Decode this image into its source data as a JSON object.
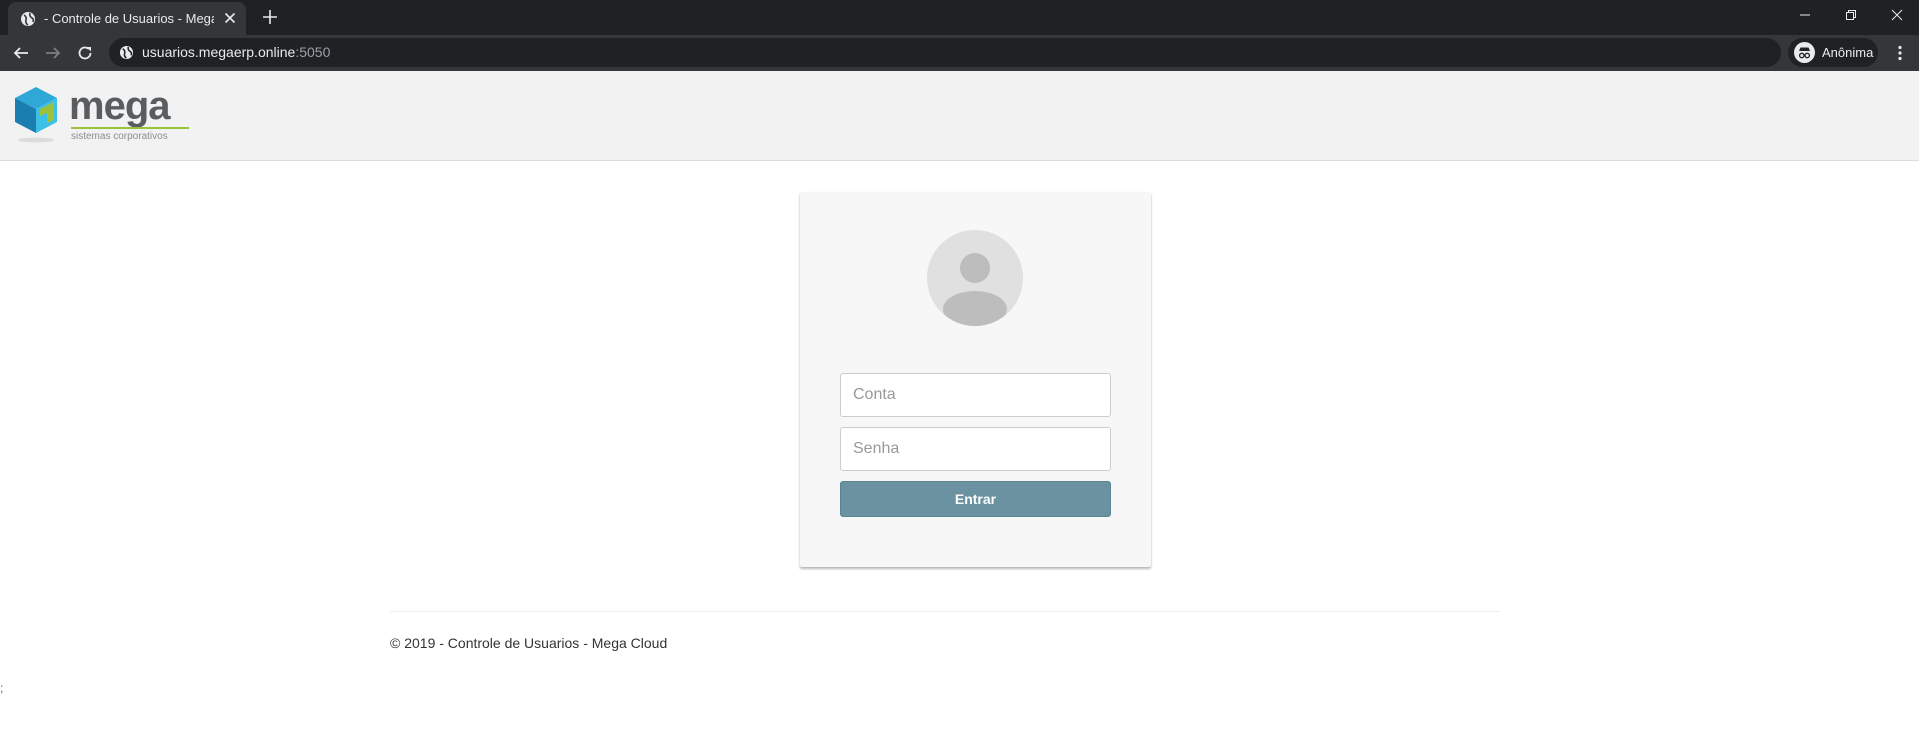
{
  "browser": {
    "tab": {
      "title": "- Controle de Usuarios - Mega Cl"
    },
    "address": {
      "host": "usuarios.megaerp.online",
      "port": ":5050"
    },
    "profile": {
      "label": "Anônima"
    }
  },
  "header": {
    "logo": {
      "word": "mega",
      "tagline": "sistemas corporativos",
      "accent_color": "#9cc23b"
    }
  },
  "login": {
    "account_placeholder": "Conta",
    "account_value": "",
    "password_placeholder": "Senha",
    "password_value": "",
    "submit_label": "Entrar",
    "button_color": "#6a92a0"
  },
  "footer": {
    "text": "© 2019 - Controle de Usuarios - Mega Cloud"
  },
  "stray_text": ";"
}
